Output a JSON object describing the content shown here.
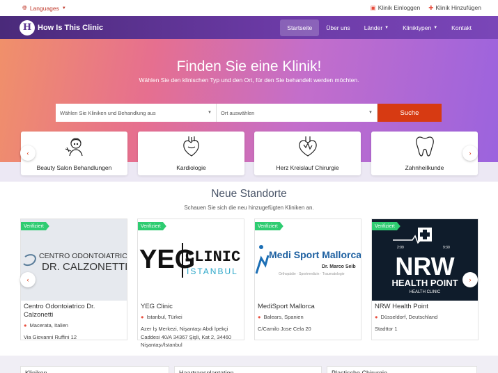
{
  "topbar": {
    "languages": "Languages",
    "login": "Klinik Einloggen",
    "add": "Klinik Hinzufügen"
  },
  "navbar": {
    "logo_text": "How Is This Clinic",
    "items": [
      "Startseite",
      "Über uns",
      "Länder",
      "Kliniktypen",
      "Kontakt"
    ],
    "active": "Startseite"
  },
  "hero": {
    "title": "Finden Sie eine Klinik!",
    "subtitle": "Wählen Sie den klinischen Typ und den Ort, für den Sie behandelt werden möchten.",
    "clinic_select": "Wählen Sie Kliniken und Behandlung aus",
    "location_select": "Ort auswählen",
    "search_button": "Suche"
  },
  "categories": [
    {
      "label": "Beauty Salon Behandlungen",
      "icon": "beauty-salon-icon"
    },
    {
      "label": "Kardiologie",
      "icon": "heart-icon"
    },
    {
      "label": "Herz Kreislauf Chirurgie",
      "icon": "cardiovascular-icon"
    },
    {
      "label": "Zahnheilkunde",
      "icon": "tooth-icon"
    }
  ],
  "new_locations": {
    "title": "Neue Standorte",
    "subtitle": "Schauen Sie sich die neu hinzugefügten Kliniken an.",
    "badge": "Verifiziert",
    "clinics": [
      {
        "name": "Centro Odontoiatrico Dr. Calzonetti",
        "location": "Macerata, Italien",
        "address": "Via Giovanni Ruffini 12",
        "logo_line1": "CENTRO ODONTOIATRICO",
        "logo_line2": "DR. CALZONETTI"
      },
      {
        "name": "YEG Clinic",
        "location": "Istanbul, Türkei",
        "address": "Azer İş Merkezi, Nişantaşı Abdi İpekçi Caddesi 40/A 34367 Şişli, Kat 2, 34460 Nişantaşı/İstanbul",
        "logo_line1": "YEG",
        "logo_line2": "CLINIC",
        "logo_line3": "ISTANBUL"
      },
      {
        "name": "MediSport Mallorca",
        "location": "Balears, Spanien",
        "address": "C/Camilo Jose Cela 20",
        "logo_line1": "Medi Sport Mallorca",
        "logo_line2": "Dr. Marco Seib",
        "logo_line3": "Orthopädie · Sportmedizin · Traumatologie"
      },
      {
        "name": "NRW Health Point",
        "location": "Düsseldorf, Deutschland",
        "address": "Stadttor 1",
        "logo_line1": "NRW",
        "logo_line2": "HEALTH POINT",
        "logo_line3": "HEALTH CLINIC",
        "logo_time_open": "2:09",
        "logo_time_close": "9:30"
      }
    ]
  },
  "bottom_tiles": [
    "Kliniken",
    "Haartransplantation",
    "Plastische Chirurgie"
  ],
  "colors": {
    "accent": "#d73a12",
    "verified": "#2ecc71",
    "nav": "#5b3490"
  }
}
